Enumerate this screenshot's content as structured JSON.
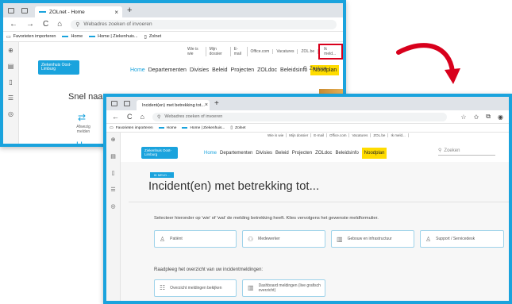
{
  "back_window": {
    "tab_title": "ZOLnet - Home",
    "address_placeholder": "Webadres zoeken of invoeren",
    "favorites": [
      "Favorieten importeren",
      "Home",
      "Home | Ziekenhuis...",
      "Zolnet"
    ],
    "util_links": [
      "Wie is wie",
      "Mijn dossier",
      "E-mail",
      "Office.com",
      "Vacatures",
      "ZOL.be",
      "Ik meld..."
    ],
    "logo_text": "Ziekenhuis Oost-Limburg",
    "main_nav": [
      "Home",
      "Departementen",
      "Divisies",
      "Beleid",
      "Projecten",
      "ZOLdoc",
      "Beleidsinfo",
      "Noodplan"
    ],
    "search_label": "Zoeken",
    "snel_title": "Snel naar",
    "tile_label": "Afwezig melden"
  },
  "front_window": {
    "tab_title": "Incident(en) met betrekking tot...",
    "address_placeholder": "Webadres zoeken of invoeren",
    "favorites": [
      "Favorieten importeren",
      "Home",
      "Home | Ziekenhuis...",
      "Zolnet"
    ],
    "util_links": [
      "Wie is wie",
      "Mijn dossier",
      "E-mail",
      "Office.com",
      "Vacatures",
      "ZOL.be",
      "Ik meld..."
    ],
    "logo_text": "Ziekenhuis Oost-Limburg",
    "main_nav": [
      "Home",
      "Departementen",
      "Divisies",
      "Beleid",
      "Projecten",
      "ZOLdoc",
      "Beleidsinfo",
      "Noodplan"
    ],
    "search_placeholder": "Zoeken",
    "badge": "IK MELD ...",
    "page_title": "Incident(en) met betrekking tot...",
    "intro_text": "Selecteer hieronder op 'wie' of 'wat' de melding betrekking heeft. Klies vervolgens het gewenste meldformulier.",
    "incident_options": [
      "Patiënt",
      "Medewerker",
      "Gebouw en infrastructuur",
      "Support / Servicedesk"
    ],
    "overview_text": "Raadpleeg het overzicht van uw incidentmeldingen:",
    "overview_buttons": [
      "Overzicht meldingen bekijken",
      "Dashboard meldingen (live grafisch overzicht)"
    ]
  },
  "colors": {
    "accent": "#1aa3dd",
    "highlight": "#d8001c",
    "noodplan": "#ffdc00",
    "arrow": "#d8001c"
  }
}
